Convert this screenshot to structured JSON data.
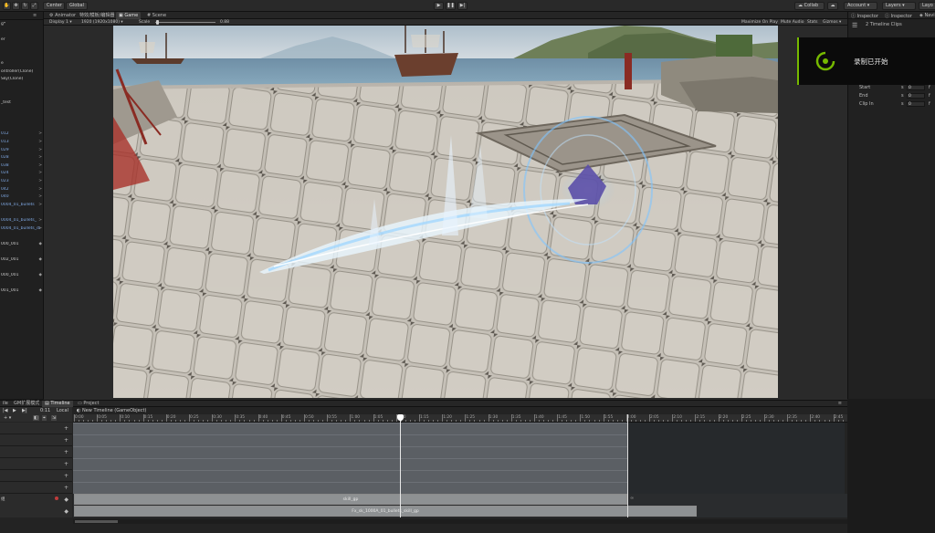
{
  "toolbar": {
    "center_label": "Center",
    "global_label": "Global",
    "collab_label": "Collab",
    "account_label": "Account",
    "layers_label": "Layers",
    "layout_label": "Layo"
  },
  "tabs": {
    "animator": "Animator",
    "effect_tab": "特效/模板/编辑器",
    "game": "Game",
    "scene": "Scene"
  },
  "game_bar": {
    "display": "Display 1",
    "resolution": "1920 (1920x1080)",
    "scale_label": "Scale",
    "scale_value": "0.88",
    "maximize": "Maximize On Play",
    "mute": "Mute Audio",
    "stats": "Stats",
    "gizmos": "Gizmos"
  },
  "hierarchy": {
    "items": [
      {
        "text": "g*",
        "num": ""
      },
      {
        "text": "",
        "num": ""
      },
      {
        "text": "er",
        "num": ""
      },
      {
        "text": "",
        "num": ""
      },
      {
        "text": "",
        "num": ""
      },
      {
        "text": "e",
        "num": ""
      },
      {
        "text": "ontroller(Clone)",
        "num": ""
      },
      {
        "text": "Sky(Clone)",
        "num": ""
      },
      {
        "text": "",
        "num": ""
      },
      {
        "text": "",
        "num": ""
      },
      {
        "text": "_test",
        "num": ""
      },
      {
        "text": "",
        "num": ""
      },
      {
        "text": "",
        "num": ">"
      },
      {
        "text": "",
        "num": ">"
      },
      {
        "text": "012",
        "num": ">"
      },
      {
        "text": "013",
        "num": ">"
      },
      {
        "text": "029",
        "num": ">"
      },
      {
        "text": "028",
        "num": ">"
      },
      {
        "text": "038",
        "num": ">"
      },
      {
        "text": "024",
        "num": ">"
      },
      {
        "text": "023",
        "num": ">"
      },
      {
        "text": "042",
        "num": ">"
      },
      {
        "text": "040",
        "num": ">"
      },
      {
        "text": "0004_01_bullets",
        "num": ">"
      },
      {
        "text": "",
        "num": ""
      },
      {
        "text": "0004_01_bullets_",
        "num": ">"
      },
      {
        "text": "0004_01_bullets_di",
        "num": ">"
      },
      {
        "text": "",
        "num": ""
      },
      {
        "text": "000_001",
        "num": "◆"
      },
      {
        "text": "",
        "num": ""
      },
      {
        "text": "002_001",
        "num": "◆"
      },
      {
        "text": "",
        "num": ""
      },
      {
        "text": "000_001",
        "num": "◆"
      },
      {
        "text": "",
        "num": ""
      },
      {
        "text": "001_001",
        "num": "◆"
      }
    ]
  },
  "inspector": {
    "tab_inspector": "Inspector",
    "tab_inspector2": "Inspector",
    "tab_nav": "Navi",
    "clips_title": "2 Timeline Clips",
    "fields": [
      {
        "label": "Start",
        "value": "0"
      },
      {
        "label": "End",
        "value": "0"
      },
      {
        "label": "Clip In",
        "value": "0"
      }
    ]
  },
  "overlay": {
    "text": "录制已开始"
  },
  "timeline": {
    "tab_left": "ile",
    "tab_gm": "GM扩展模式",
    "tab_timeline": "Timeline",
    "tab_project": "Project",
    "title": "New Timeline (GameObject)",
    "frame": "0:11",
    "local": "Local",
    "ruler": [
      "0:00",
      "0:05",
      "0:10",
      "0:15",
      "0:20",
      "0:25",
      "0:30",
      "0:35",
      "0:40",
      "0:45",
      "0:50",
      "0:55",
      "1:00",
      "1:05",
      "1:10",
      "1:15",
      "1:20",
      "1:25",
      "1:30",
      "1:35",
      "1:40",
      "1:45",
      "1:50",
      "1:55",
      "2:00",
      "2:05",
      "2:10",
      "2:15",
      "2:20",
      "2:25",
      "2:30",
      "2:35",
      "2:40",
      "2:45"
    ],
    "clip1": "skill_gp",
    "clip2": "Fx_sk_1000A_01_bullets_skill_gp",
    "row_label": "组",
    "clip_marker": "∞"
  }
}
